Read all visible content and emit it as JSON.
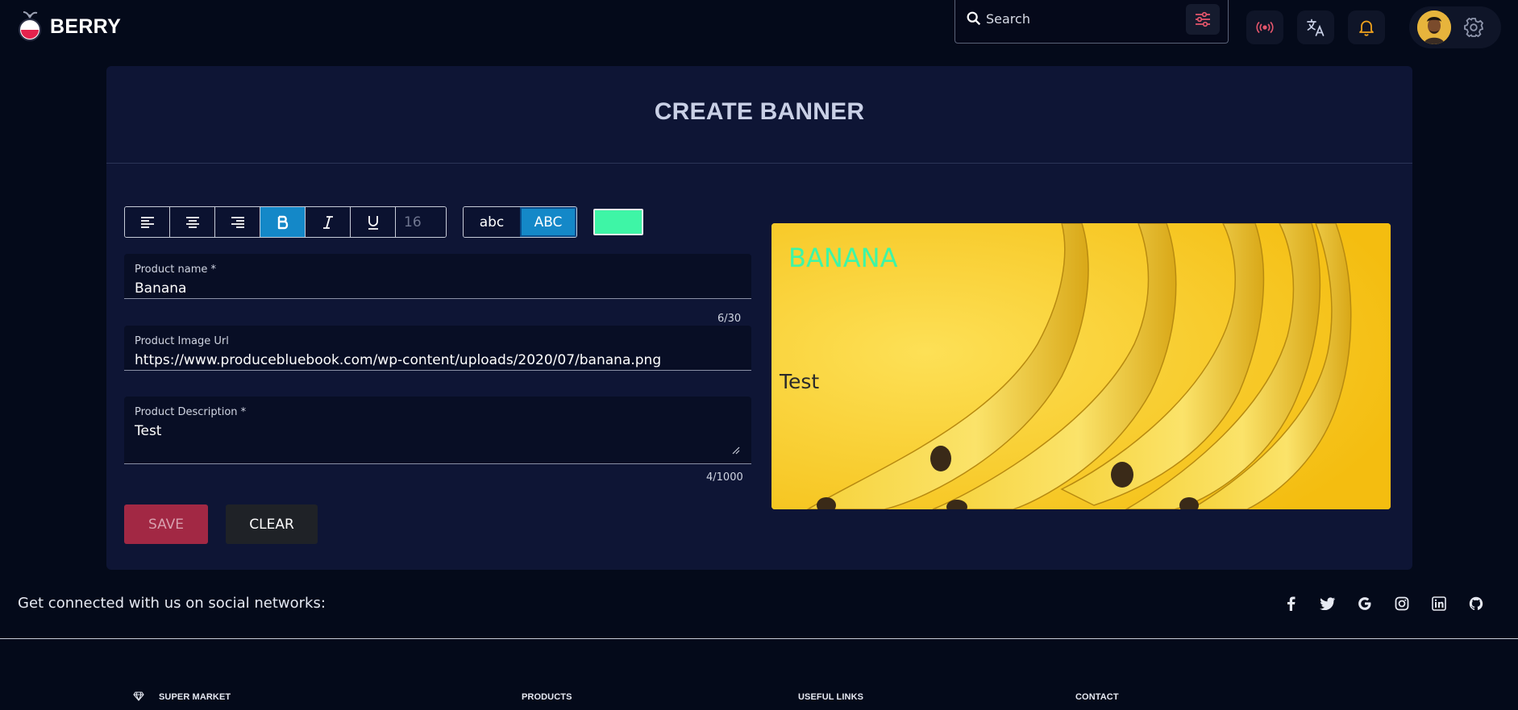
{
  "header": {
    "brand": "BERRY",
    "search_placeholder": "Search"
  },
  "card": {
    "title": "CREATE BANNER"
  },
  "toolbar": {
    "font_size": "16",
    "case_lower": "abc",
    "case_upper": "ABC",
    "text_color": "#3ef5a6"
  },
  "form": {
    "product_name": {
      "label": "Product name *",
      "value": "Banana",
      "counter": "6/30"
    },
    "image_url": {
      "label": "Product Image Url",
      "value": "https://www.producebluebook.com/wp-content/uploads/2020/07/banana.png"
    },
    "description": {
      "label": "Product Description *",
      "value": "Test",
      "counter": "4/1000"
    },
    "save_label": "SAVE",
    "clear_label": "CLEAR"
  },
  "banner": {
    "name": "BANANA",
    "description": "Test"
  },
  "footer": {
    "social_text": "Get connected with us on social networks:",
    "columns": [
      "SUPER MARKET",
      "PRODUCTS",
      "USEFUL LINKS",
      "CONTACT"
    ],
    "social_icons": [
      "facebook-icon",
      "twitter-icon",
      "google-icon",
      "instagram-icon",
      "linkedin-icon",
      "github-icon"
    ]
  },
  "colors": {
    "accent": "#1488c8",
    "save": "#a22844",
    "background": "#040a1a",
    "card": "#0e1535"
  }
}
